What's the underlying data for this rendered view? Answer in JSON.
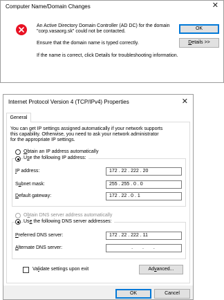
{
  "error_dialog": {
    "title": "Computer Name/Domain Changes",
    "message_line1": "An Active Directory Domain Controller (AD DC) for the domain",
    "message_line2": "\"corp.vasaorg.sk\" could not be contacted.",
    "message_hint": "Ensure that the domain name is typed correctly.",
    "message_details": "If the name is correct, click Details for troubleshooting information.",
    "ok_label": "OK",
    "details_label": "Details >>"
  },
  "ipv4_dialog": {
    "title": "Internet Protocol Version 4 (TCP/IPv4) Properties",
    "tab_general": "General",
    "intro_line1": "You can get IP settings assigned automatically if your network supports",
    "intro_line2": "this capability. Otherwise, you need to ask your network administrator",
    "intro_line3": "for the appropriate IP settings.",
    "obtain_ip_auto": "Obtain an IP address automatically",
    "use_following_ip": "Use the following IP address:",
    "ip_address_label": "IP address:",
    "ip_address_value": "172 . 22 . 222 . 20",
    "subnet_label": "Subnet mask:",
    "subnet_value": "255 . 255 . 0 . 0",
    "gateway_label": "Default gateway:",
    "gateway_value": "172 . 22 . 0 . 1",
    "obtain_dns_auto": "Obtain DNS server address automatically",
    "use_following_dns": "Use the following DNS server addresses:",
    "preferred_dns_label": "Preferred DNS server:",
    "preferred_dns_value": "172 . 22 . 222 . 11",
    "alternate_dns_label": "Alternate DNS server:",
    "alternate_dns_value": ". . .",
    "validate_label": "Validate settings upon exit",
    "advanced_label": "Advanced...",
    "ok_label": "OK",
    "cancel_label": "Cancel"
  },
  "icons": {
    "error": "error-icon",
    "close": "close-icon"
  },
  "colors": {
    "error_red": "#e81123",
    "accent_blue": "#0078d7",
    "button_gray": "#e1e1e1",
    "footer_gray": "#f0f0f0"
  }
}
